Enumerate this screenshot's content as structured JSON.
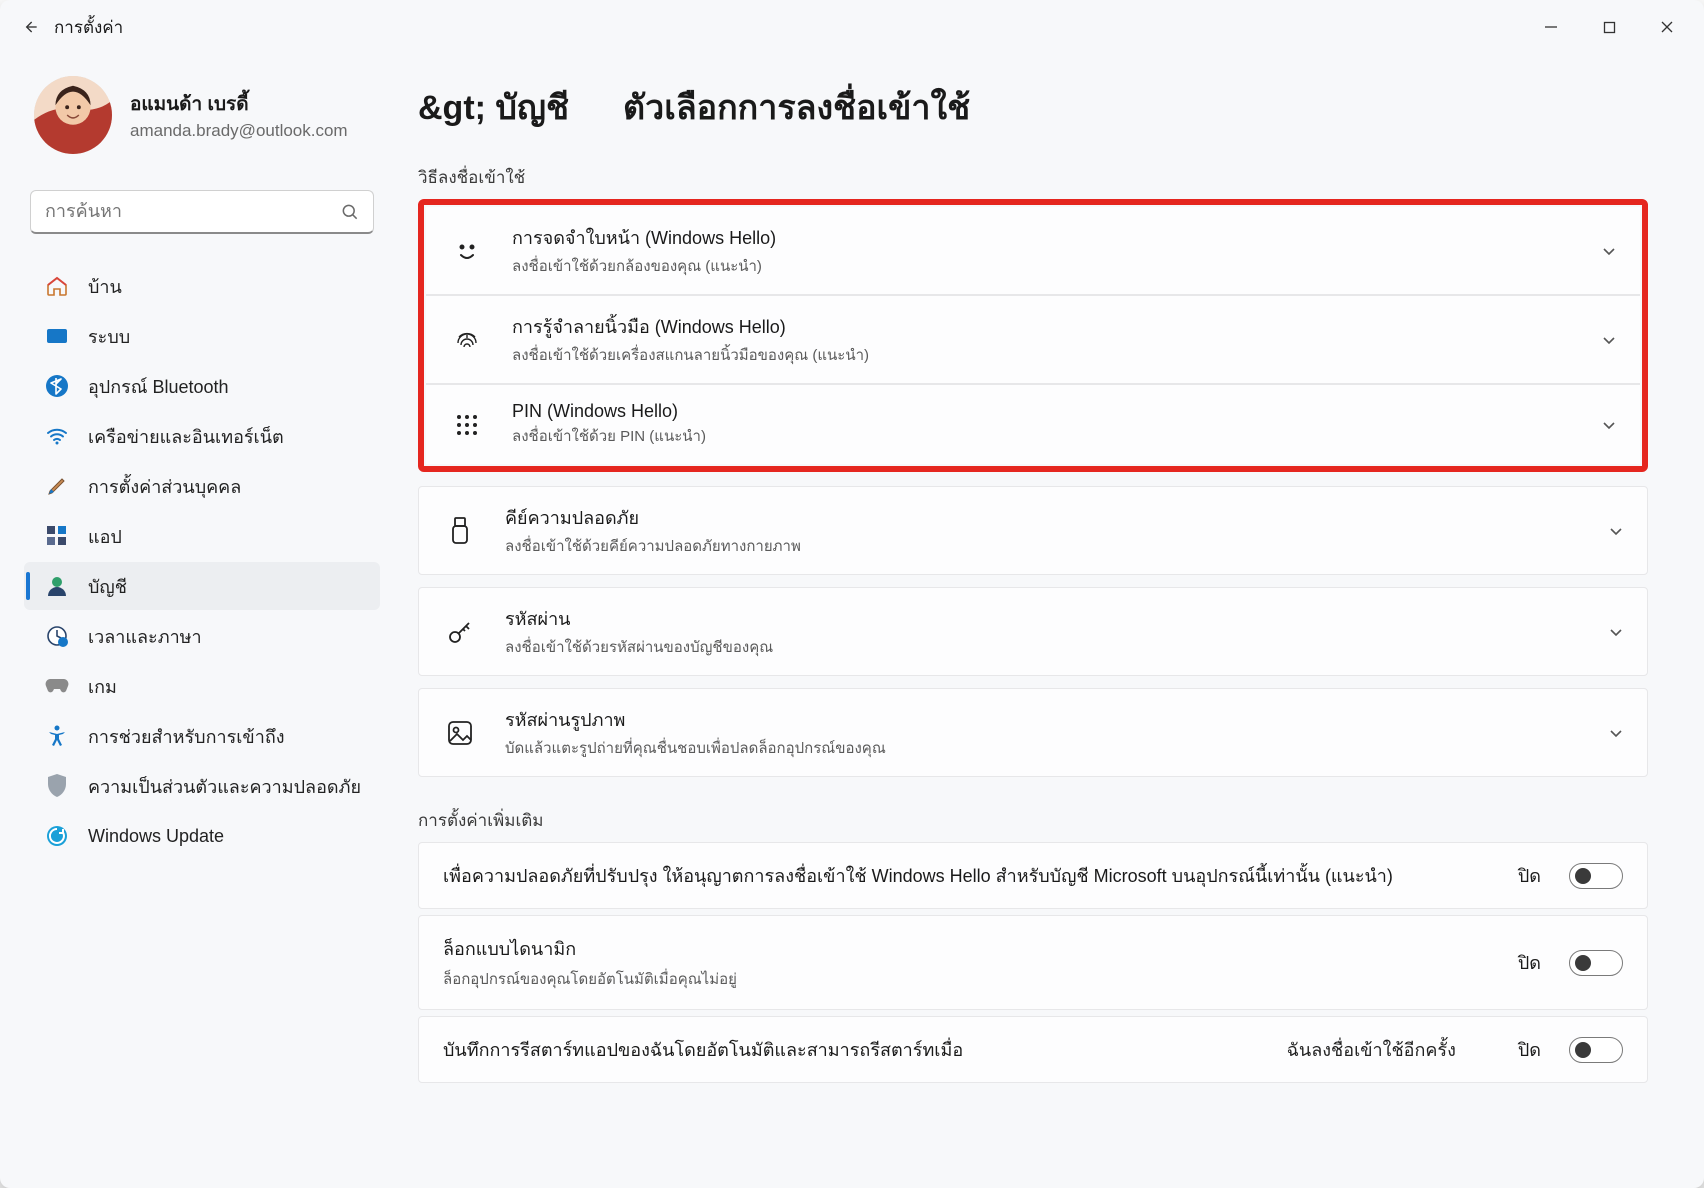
{
  "window": {
    "app_title": "การตั้งค่า"
  },
  "user": {
    "name": "อแมนด้า เบรดี้",
    "email": "amanda.brady@outlook.com"
  },
  "search": {
    "placeholder": "การค้นหา"
  },
  "sidebar": {
    "items": [
      {
        "label": "บ้าน"
      },
      {
        "label": "ระบบ"
      },
      {
        "label": "อุปกรณ์ Bluetooth"
      },
      {
        "label": "เครือข่ายและอินเทอร์เน็ต"
      },
      {
        "label": "การตั้งค่าส่วนบุคคล"
      },
      {
        "label": "แอป"
      },
      {
        "label": "บัญชี"
      },
      {
        "label": "เวลาและภาษา"
      },
      {
        "label": "เกม"
      },
      {
        "label": "การช่วยสำหรับการเข้าถึง"
      },
      {
        "label": "ความเป็นส่วนตัวและความปลอดภัย"
      },
      {
        "label": "Windows Update"
      }
    ]
  },
  "breadcrumb": {
    "left": "&gt; บัญชี",
    "right": "ตัวเลือกการลงชื่อเข้าใช้"
  },
  "signin_section_label": "วิธีลงชื่อเข้าใช้",
  "signin_options": [
    {
      "title": "การจดจำใบหน้า (Windows Hello)",
      "sub": "ลงชื่อเข้าใช้ด้วยกล้องของคุณ (แนะนำ)"
    },
    {
      "title": "การรู้จำลายนิ้วมือ (Windows Hello)",
      "sub": "ลงชื่อเข้าใช้ด้วยเครื่องสแกนลายนิ้วมือของคุณ (แนะนำ)"
    },
    {
      "title": "PIN (Windows Hello)",
      "sub": "ลงชื่อเข้าใช้ด้วย    PIN (แนะนำ)"
    },
    {
      "title": "คีย์ความปลอดภัย",
      "sub": "ลงชื่อเข้าใช้ด้วยคีย์ความปลอดภัยทางกายภาพ"
    },
    {
      "title": "รหัสผ่าน",
      "sub": "ลงชื่อเข้าใช้ด้วยรหัสผ่านของบัญชีของคุณ"
    },
    {
      "title": "รหัสผ่านรูปภาพ",
      "sub": "บัดแล้วแตะรูปถ่ายที่คุณชื่นชอบเพื่อปลดล็อกอุปกรณ์ของคุณ"
    }
  ],
  "more_section_label": "การตั้งค่าเพิ่มเติม",
  "more_rows": [
    {
      "title": "เพื่อความปลอดภัยที่ปรับปรุง ให้อนุญาตการลงชื่อเข้าใช้ Windows Hello สำหรับบัญชี Microsoft บนอุปกรณ์นี้เท่านั้น (แนะนำ)",
      "state": "ปิด"
    },
    {
      "title": "ล็อกแบบไดนามิก",
      "sub": "ล็อกอุปกรณ์ของคุณโดยอัตโนมัติเมื่อคุณไม่อยู่",
      "state": "ปิด"
    },
    {
      "title": "บันทึกการรีสตาร์ทแอปของฉันโดยอัตโนมัติและสามารถรีสตาร์ทเมื่อ",
      "mid": "ฉันลงชื่อเข้าใช้อีกครั้ง",
      "state": "ปิด"
    }
  ]
}
